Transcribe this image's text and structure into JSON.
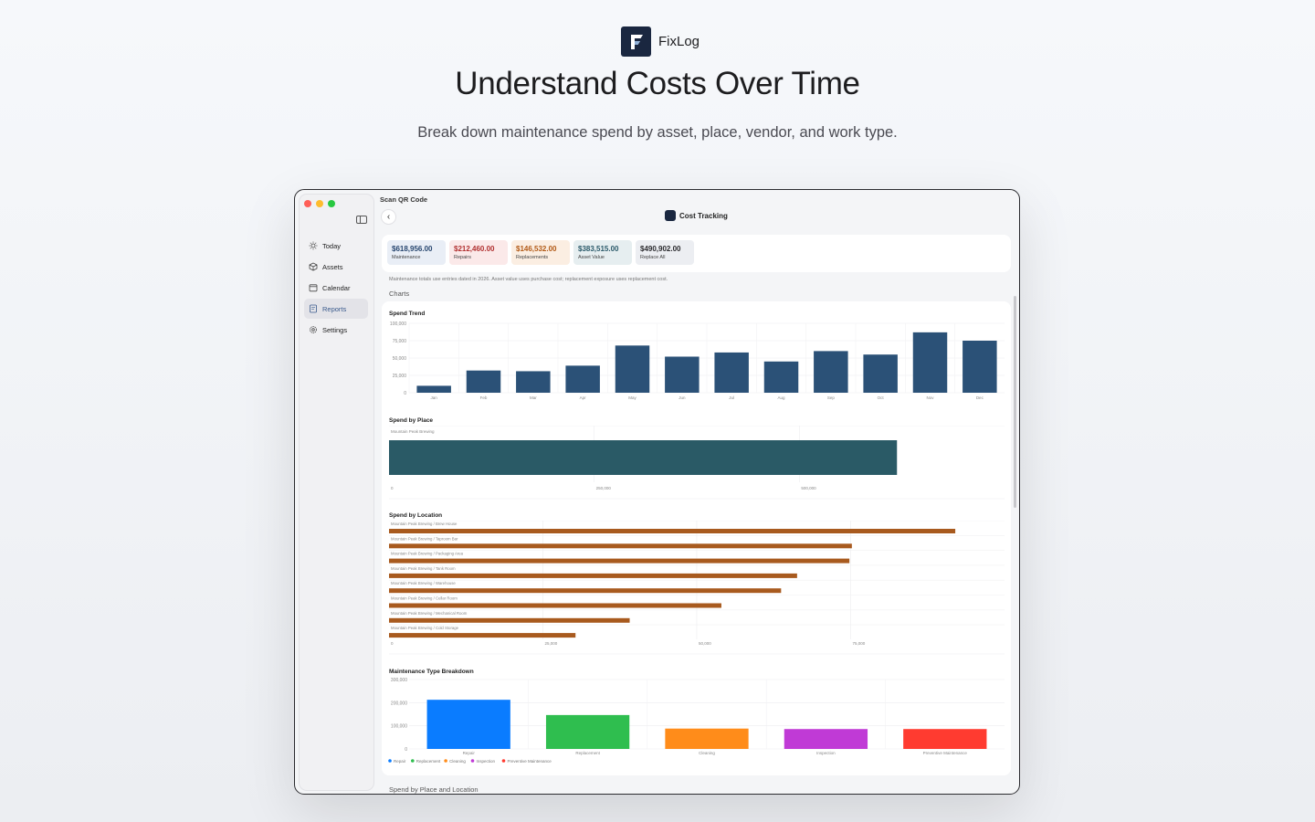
{
  "brand": {
    "name": "FixLog"
  },
  "hero": {
    "title": "Understand Costs Over Time",
    "subtitle": "Break down maintenance spend by asset, place, vendor, and work type."
  },
  "app": {
    "top_label": "Scan QR Code",
    "screen_title": "Cost Tracking",
    "nav": [
      {
        "label": "Today",
        "icon": "sun-icon"
      },
      {
        "label": "Assets",
        "icon": "cube-icon"
      },
      {
        "label": "Calendar",
        "icon": "calendar-icon"
      },
      {
        "label": "Reports",
        "icon": "report-icon",
        "active": true
      },
      {
        "label": "Settings",
        "icon": "gear-icon"
      }
    ],
    "stats": [
      {
        "value": "$618,956.00",
        "label": "Maintenance",
        "bg": "#e9eef6",
        "color": "#27466f"
      },
      {
        "value": "$212,460.00",
        "label": "Repairs",
        "bg": "#fbe9e9",
        "color": "#b13030"
      },
      {
        "value": "$146,532.00",
        "label": "Replacements",
        "bg": "#fbeee2",
        "color": "#b25a16"
      },
      {
        "value": "$383,515.00",
        "label": "Asset Value",
        "bg": "#e6eef0",
        "color": "#2b5a6a"
      },
      {
        "value": "$490,902.00",
        "label": "Replace All",
        "bg": "#eceef2",
        "color": "#2a2a2e"
      }
    ],
    "note": "Maintenance totals use entries dated in 2026. Asset value uses purchase cost; replacement exposure uses replacement cost.",
    "charts_heading": "Charts",
    "bottom_heading": "Spend by Place and Location"
  },
  "chart_data": [
    {
      "type": "bar",
      "title": "Spend Trend",
      "categories": [
        "Jan",
        "Feb",
        "Mar",
        "Apr",
        "May",
        "Jun",
        "Jul",
        "Aug",
        "Sep",
        "Oct",
        "Nov",
        "Dec"
      ],
      "values": [
        10000,
        32000,
        31000,
        39000,
        68000,
        52000,
        58000,
        45000,
        60000,
        55000,
        87000,
        75000
      ],
      "yticks": [
        "0",
        "25,000",
        "50,000",
        "75,000",
        "100,000"
      ],
      "ylim": [
        0,
        100000
      ],
      "color": "#2b5177"
    },
    {
      "type": "bar",
      "orientation": "horizontal",
      "title": "Spend by Place",
      "categories": [
        "Mountain Peak Brewing"
      ],
      "values": [
        618956
      ],
      "xticks": [
        "0",
        "250,000",
        "500,000"
      ],
      "xlim": [
        0,
        750000
      ],
      "color": "#2a5a66"
    },
    {
      "type": "bar",
      "orientation": "horizontal",
      "title": "Spend by Location",
      "categories": [
        "Mountain Peak Brewing / Brew House",
        "Mountain Peak Brewing / Taproom Bar",
        "Mountain Peak Brewing / Packaging Area",
        "Mountain Peak Brewing / Tank Room",
        "Mountain Peak Brewing / Warehouse",
        "Mountain Peak Brewing / Cellar Room",
        "Mountain Peak Brewing / Mechanical Room",
        "Mountain Peak Brewing / Cold Storage"
      ],
      "values": [
        92000,
        75200,
        74800,
        66300,
        63700,
        54000,
        39100,
        30300
      ],
      "xticks": [
        "0",
        "25,000",
        "50,000",
        "75,000"
      ],
      "xlim": [
        0,
        100000
      ],
      "color": "#a85a1e"
    },
    {
      "type": "bar",
      "title": "Maintenance Type Breakdown",
      "categories": [
        "Repair",
        "Replacement",
        "Cleaning",
        "Inspection",
        "Preventive Maintenance"
      ],
      "values": [
        212460,
        146532,
        88000,
        86000,
        86000
      ],
      "colors": [
        "#0a7cff",
        "#2fbe4f",
        "#ff8c1a",
        "#c03ad6",
        "#ff3b30"
      ],
      "yticks": [
        "0",
        "100,000",
        "200,000",
        "300,000"
      ],
      "ylim": [
        0,
        300000
      ],
      "legend": [
        "Repair",
        "Replacement",
        "Cleaning",
        "Inspection",
        "Preventive Maintenance"
      ],
      "legend_position": "bottom-left"
    }
  ]
}
